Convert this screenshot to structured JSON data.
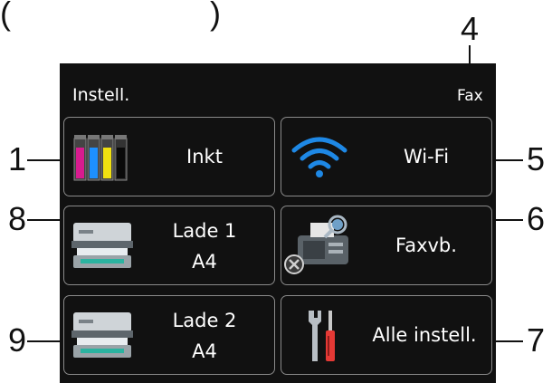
{
  "screen_title": "Instell.",
  "status_fax": "Fax",
  "callouts": [
    "1",
    "4",
    "5",
    "6",
    "7",
    "8",
    "9"
  ],
  "tiles": [
    {
      "label": "Inkt",
      "icon": "ink-cartridges-icon"
    },
    {
      "label": "Wi-Fi",
      "icon": "wifi-icon"
    },
    {
      "label": "Lade 1",
      "sub": "A4",
      "icon": "printer-tray-icon"
    },
    {
      "label": "Faxvb.",
      "icon": "fax-preview-icon"
    },
    {
      "label": "Lade 2",
      "sub": "A4",
      "icon": "printer-tray-icon"
    },
    {
      "label": "Alle instell.",
      "icon": "tools-icon"
    }
  ],
  "colors": {
    "cyan": "#1e90ff",
    "magenta": "#d81b8f",
    "yellow": "#f0e010",
    "black": "#0a0a0a",
    "wifi": "#1e88e5",
    "screwdriver": "#e53935"
  }
}
